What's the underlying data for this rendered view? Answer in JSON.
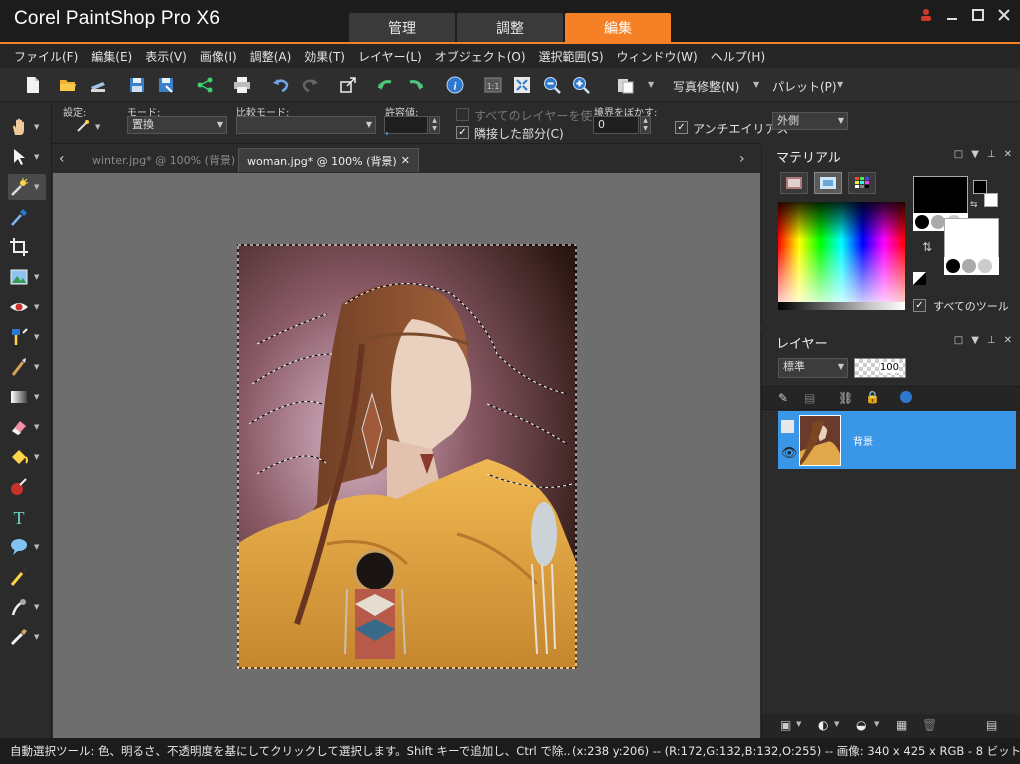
{
  "app": {
    "title": "Corel PaintShop Pro X6",
    "workspace_tabs": [
      {
        "label": "管理",
        "active": false
      },
      {
        "label": "調整",
        "active": false
      },
      {
        "label": "編集",
        "active": true
      }
    ],
    "accent_color": "#f58025"
  },
  "menu": [
    "ファイル(F)",
    "編集(E)",
    "表示(V)",
    "画像(I)",
    "調整(A)",
    "効果(T)",
    "レイヤー(L)",
    "オブジェクト(O)",
    "選択範囲(S)",
    "ウィンドウ(W)",
    "ヘルプ(H)"
  ],
  "toolbar": {
    "photo_fix_label": "写真修整(N)",
    "palette_label": "パレット(P)"
  },
  "options": {
    "preset_label": "設定:",
    "mode_label": "モード:",
    "mode_value": "置換",
    "match_mode_label": "比較モード:",
    "tolerance_label": "許容値:",
    "use_all_layers_label": "すべてのレイヤーを使う",
    "contiguous_label": "隣接した部分(C)",
    "feather_label": "境界をぼかす:",
    "feather_value": "0",
    "antialias_label": "アンチエイリアス",
    "antialias_mode": "外側"
  },
  "documents": [
    {
      "label": "winter.jpg* @ 100% (背景)",
      "active": false
    },
    {
      "label": "woman.jpg* @ 100% (背景)",
      "active": true
    }
  ],
  "materials": {
    "title": "マテリアル",
    "all_tools_label": "すべてのツール"
  },
  "layers": {
    "title": "レイヤー",
    "blend_mode": "標準",
    "opacity": "100",
    "layer_name": "背景"
  },
  "status": {
    "hint": "自動選択ツール: 色、明るさ、不透明度を基にしてクリックして選択します。Shift キーで追加し、Ctrl で除...",
    "info": "(x:238 y:206) -- (R:172,G:132,B:132,O:255) -- 画像: 340 x 425 x RGB - 8 ビット/チャネル"
  }
}
